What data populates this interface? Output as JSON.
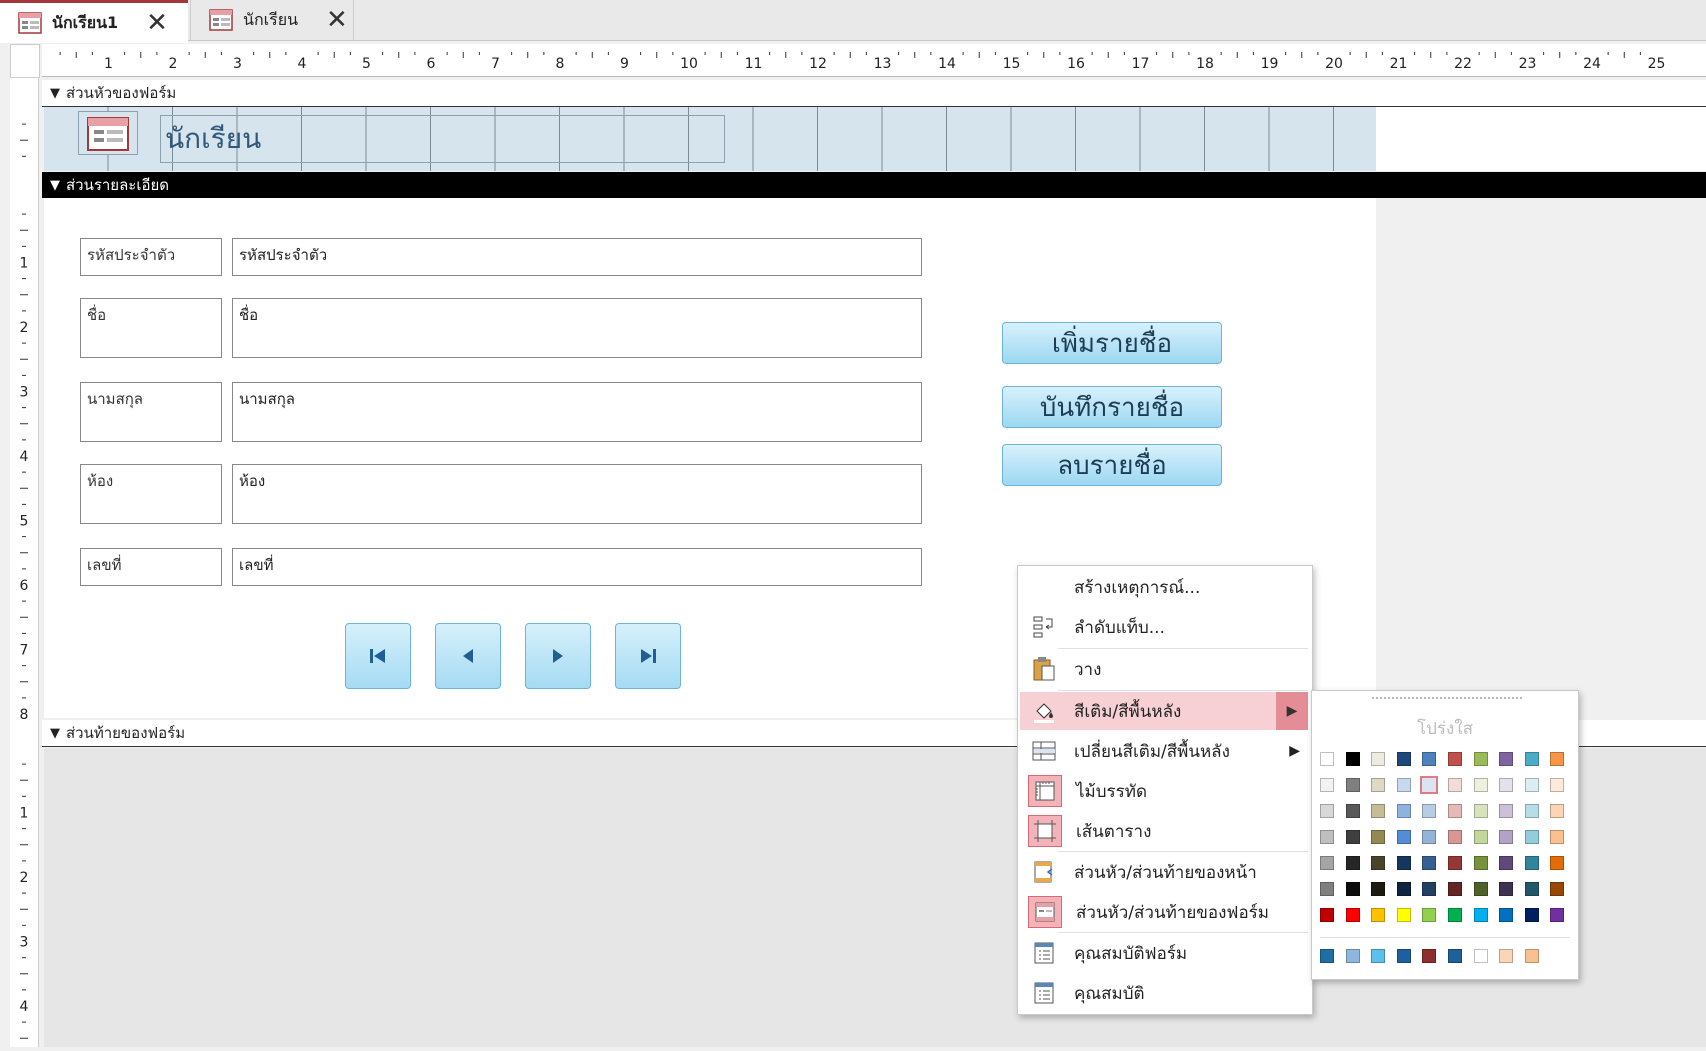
{
  "tabs": [
    {
      "label": "นักเรียน1",
      "active": true
    },
    {
      "label": "นักเรียน",
      "active": false
    }
  ],
  "ruler": {
    "h_numbers": [
      "1",
      "2",
      "3",
      "4",
      "5",
      "6",
      "7",
      "8",
      "9",
      "10",
      "11",
      "12",
      "13",
      "14",
      "15",
      "16",
      "17",
      "18",
      "19",
      "20",
      "21",
      "22",
      "23",
      "24",
      "25"
    ],
    "v_header": [],
    "v_detail": [
      "1",
      "2",
      "3",
      "4",
      "5",
      "6",
      "7",
      "8"
    ],
    "v_footer": [
      "1",
      "2",
      "3",
      "4"
    ]
  },
  "sections": {
    "header": "ส่วนหัวของฟอร์ม",
    "detail": "ส่วนรายละเอียด",
    "footer": "ส่วนท้ายของฟอร์ม"
  },
  "form_title": "นักเรียน",
  "fields": [
    {
      "label": "รหัสประจำตัว",
      "value": "รหัสประจำตัว"
    },
    {
      "label": "ชื่อ",
      "value": "ชื่อ"
    },
    {
      "label": "นามสกุล",
      "value": "นามสกุล"
    },
    {
      "label": "ห้อง",
      "value": "ห้อง"
    },
    {
      "label": "เลขที่",
      "value": "เลขที่"
    }
  ],
  "buttons": {
    "add": "เพิ่มรายชื่อ",
    "save": "บันทึกรายชื่อ",
    "delete": "ลบรายชื่อ"
  },
  "nav_icons": [
    "first-record-icon",
    "previous-record-icon",
    "next-record-icon",
    "last-record-icon"
  ],
  "context_menu": {
    "items": [
      {
        "label": "สร้างเหตุการณ์...",
        "icon": ""
      },
      {
        "label": "ลำดับแท็บ...",
        "icon": "tab-order-icon"
      },
      {
        "label": "วาง",
        "icon": "paste-icon"
      },
      {
        "label": "สีเติม/สีพื้นหลัง",
        "icon": "fill-bucket-icon",
        "submenu": true
      },
      {
        "label": "เปลี่ยนสีเติม/สีพื้นหลัง",
        "icon": "alternate-fill-icon",
        "submenu": true
      },
      {
        "label": "ไม้บรรทัด",
        "icon": "ruler-icon"
      },
      {
        "label": "เส้นตาราง",
        "icon": "gridlines-icon"
      },
      {
        "label": "ส่วนหัว/ส่วนท้ายของหน้า",
        "icon": "page-header-footer-icon"
      },
      {
        "label": "ส่วนหัว/ส่วนท้ายของฟอร์ม",
        "icon": "form-header-footer-icon"
      },
      {
        "label": "คุณสมบัติฟอร์ม",
        "icon": "form-properties-icon"
      },
      {
        "label": "คุณสมบัติ",
        "icon": "properties-icon"
      }
    ]
  },
  "palette": {
    "transparent_label": "โปร่งใส",
    "rows": [
      [
        "#ffffff",
        "#000000",
        "#eeece1",
        "#1f497d",
        "#4f81bd",
        "#c0504d",
        "#9bbb59",
        "#8064a2",
        "#4bacc6",
        "#f79646"
      ],
      [
        "#f2f2f2",
        "#7f7f7f",
        "#ddd9c3",
        "#c6d9f0",
        "#dbe5f1",
        "#f2dcdb",
        "#ebf1dd",
        "#e5e0ec",
        "#dbeef3",
        "#fdeada"
      ],
      [
        "#d8d8d8",
        "#595959",
        "#c4bd97",
        "#8db3e2",
        "#b8cce4",
        "#e5b9b7",
        "#d7e3bc",
        "#ccc1d9",
        "#b7dde8",
        "#fbd5b5"
      ],
      [
        "#bfbfbf",
        "#3f3f3f",
        "#938953",
        "#548dd4",
        "#95b3d7",
        "#d99694",
        "#c3d69b",
        "#b2a2c7",
        "#92cddc",
        "#fac08f"
      ],
      [
        "#a5a5a5",
        "#262626",
        "#494429",
        "#17365d",
        "#366092",
        "#953734",
        "#76923c",
        "#5f497a",
        "#31859b",
        "#e36c09"
      ],
      [
        "#7f7f7f",
        "#0c0c0c",
        "#1d1b10",
        "#0f243e",
        "#244061",
        "#632423",
        "#4f6128",
        "#3f3151",
        "#205867",
        "#974806"
      ],
      [
        "#c00000",
        "#ff0000",
        "#ffc000",
        "#ffff00",
        "#92d050",
        "#00b050",
        "#00b0f0",
        "#0070c0",
        "#002060",
        "#7030a0"
      ]
    ],
    "recent": [
      "#1f6fa3",
      "#8fb7de",
      "#5bc0eb",
      "#1f5fa0",
      "#8b2f2f",
      "#1f5f9a",
      "#ffffff",
      "#fbd5b5",
      "#fac08f"
    ]
  }
}
